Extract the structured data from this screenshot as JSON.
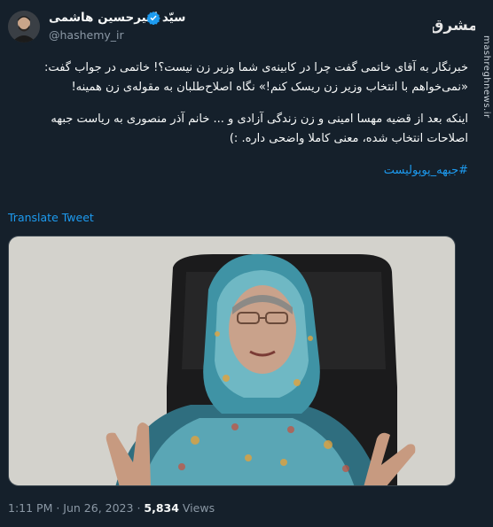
{
  "author": {
    "display_name": "سیّد امیرحسین هاشمی",
    "handle": "@hashemy_ir",
    "verified": true
  },
  "watermark": {
    "logo_text": "مشرق",
    "site": "mashreghnews.ir"
  },
  "tweet": {
    "paragraph1": "خبرنگار به آقای خاتمی گفت چرا در کابینه‌ی شما وزیر زن نیست؟! خاتمی در جواب گفت: «نمی‌خواهم با انتخاب وزیر زن ریسک کنم!» نگاه اصلاح‌طلبان به مقوله‌ی زن همینه!",
    "paragraph2": "اینکه بعد از قضیه مهسا امینی و زن زندگی آزادی و ... خانم آذر منصوری به ریاست جبهه اصلاحات انتخاب شده، معنی کاملا واضحی داره. :)",
    "hashtag": "#جبهه_پوپولیست"
  },
  "translate_label": "Translate Tweet",
  "meta": {
    "time": "1:11 PM",
    "separator": " · ",
    "date": "Jun 26, 2023",
    "views_count": "5,834",
    "views_label": " Views"
  },
  "colors": {
    "background": "#15202b",
    "link": "#1d9bf0",
    "muted": "#8b98a5"
  }
}
